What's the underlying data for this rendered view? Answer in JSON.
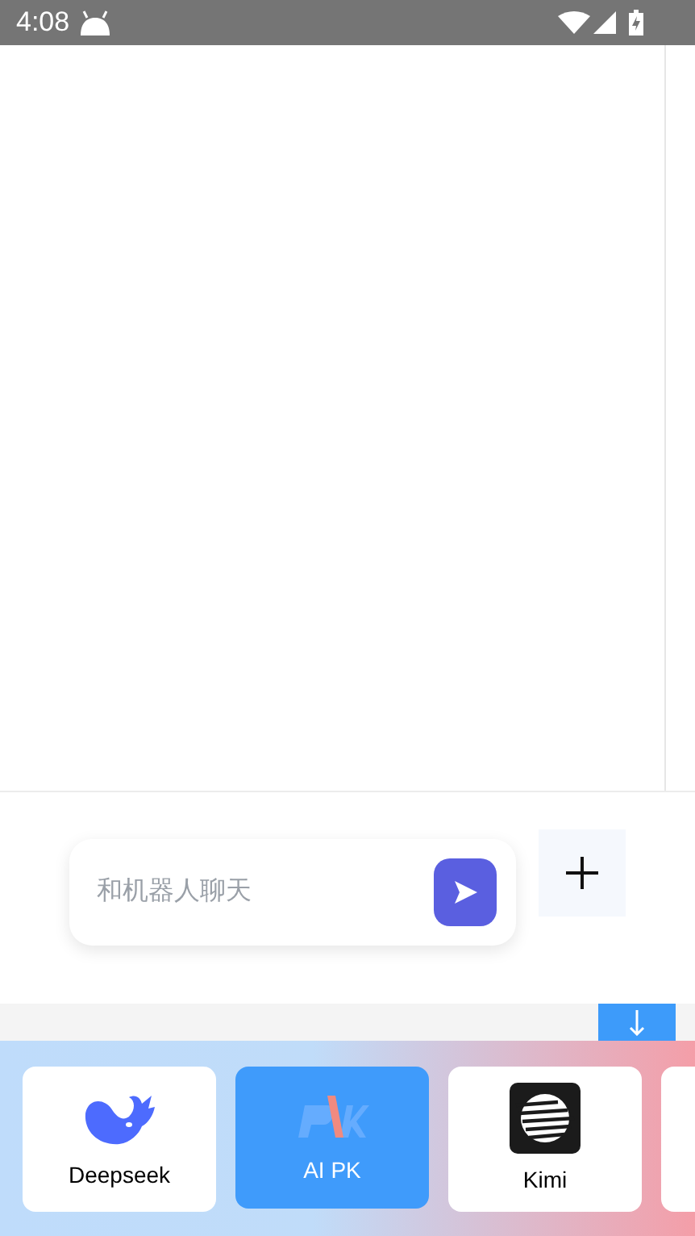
{
  "status_bar": {
    "time": "4:08"
  },
  "chat_input": {
    "placeholder": "和机器人聊天"
  },
  "models": [
    {
      "label": "Deepseek",
      "selected": false
    },
    {
      "label": "AI PK",
      "selected": true
    },
    {
      "label": "Kimi",
      "selected": false
    }
  ]
}
